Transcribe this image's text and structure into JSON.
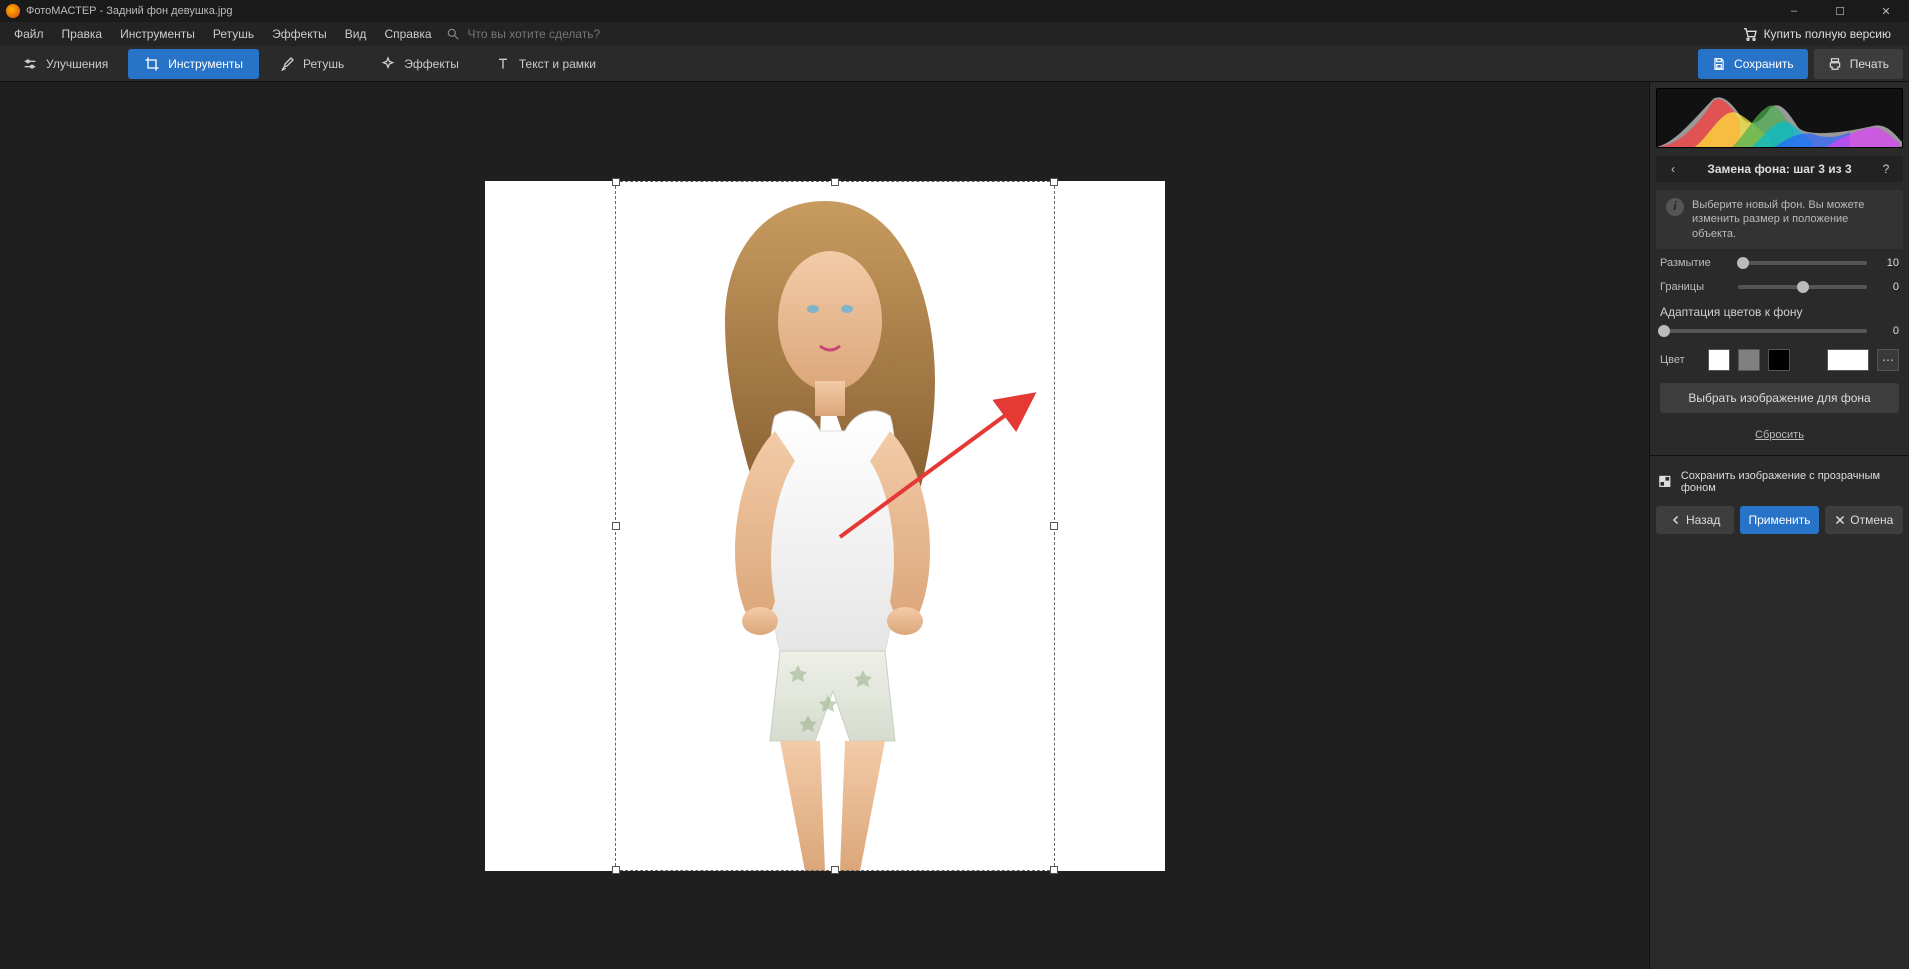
{
  "title": "ФотоМАСТЕР - Задний фон девушка.jpg",
  "window_controls": {
    "min": "–",
    "max": "☐",
    "close": "✕"
  },
  "menu": [
    "Файл",
    "Правка",
    "Инструменты",
    "Ретушь",
    "Эффекты",
    "Вид",
    "Справка"
  ],
  "search_placeholder": "Что вы хотите сделать?",
  "buy_full": "Купить полную версию",
  "tabs": [
    {
      "id": "improve",
      "label": "Улучшения",
      "active": false
    },
    {
      "id": "tools",
      "label": "Инструменты",
      "active": true
    },
    {
      "id": "retouch",
      "label": "Ретушь",
      "active": false
    },
    {
      "id": "effects",
      "label": "Эффекты",
      "active": false
    },
    {
      "id": "text",
      "label": "Текст и рамки",
      "active": false
    }
  ],
  "toolbar_right": {
    "save": "Сохранить",
    "print": "Печать"
  },
  "rpanel": {
    "header": "Замена фона: шаг 3 из 3",
    "info": "Выберите новый фон. Вы можете изменить размер и положение объекта.",
    "sliders": [
      {
        "id": "blur",
        "label": "Размытие",
        "value": 10,
        "pos_pct": 4
      },
      {
        "id": "edges",
        "label": "Границы",
        "value": 0,
        "pos_pct": 50
      },
      {
        "id": "adapt",
        "label": "Адаптация цветов к фону",
        "value": 0,
        "pos_pct": 2,
        "full": true
      }
    ],
    "color_label": "Цвет",
    "swatches": [
      "#ffffff",
      "#808080",
      "#000000"
    ],
    "current_color": "#ffffff",
    "choose_bg": "Выбрать изображение для фона",
    "reset": "Сбросить",
    "save_transparent": "Сохранить изображение с прозрачным фоном",
    "actions": {
      "back": "Назад",
      "apply": "Применить",
      "cancel": "Отмена"
    }
  }
}
